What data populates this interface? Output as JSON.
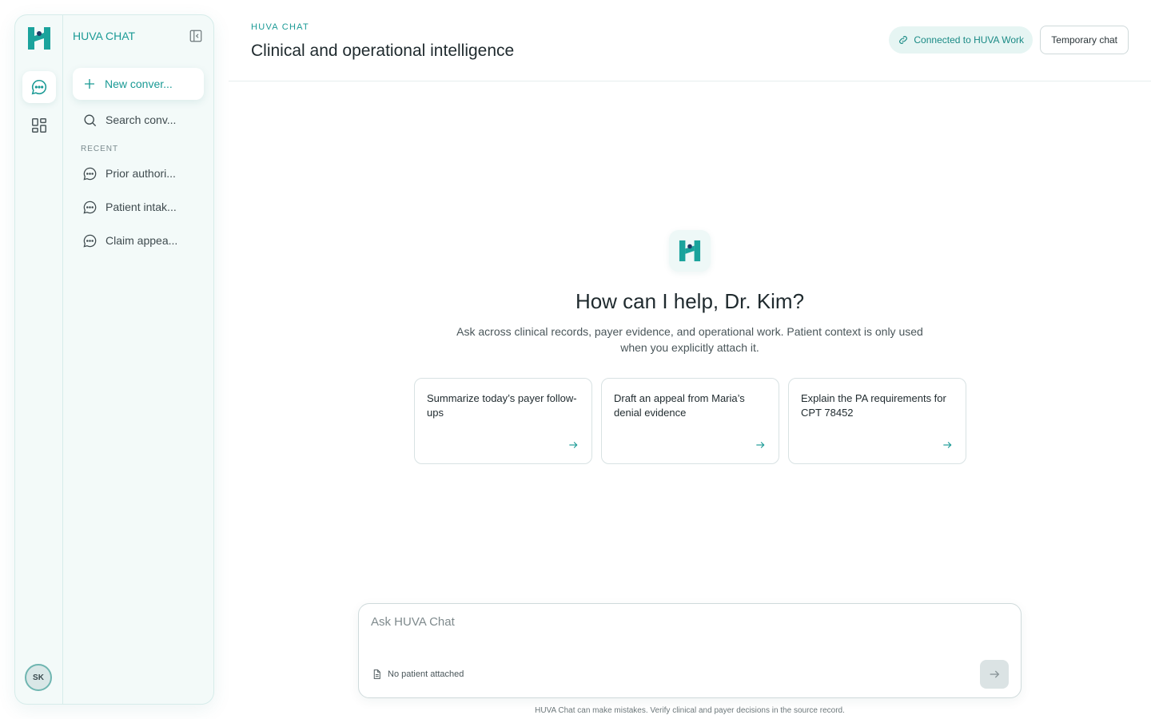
{
  "sidebar": {
    "brand": "HUVA CHAT",
    "new_conversation": "New conver...",
    "search": "Search conv...",
    "recent_label": "RECENT",
    "recent": [
      {
        "label": "Prior authori..."
      },
      {
        "label": "Patient intak..."
      },
      {
        "label": "Claim appea..."
      }
    ],
    "avatar_initials": "SK"
  },
  "header": {
    "eyebrow": "HUVA CHAT",
    "title": "Clinical and operational intelligence",
    "connection": "Connected to HUVA Work",
    "temporary": "Temporary chat"
  },
  "hero": {
    "greeting": "How can I help, Dr. Kim?",
    "subtitle": "Ask across clinical records, payer evidence, and operational work. Patient context is only used when you explicitly attach it."
  },
  "suggestions": [
    {
      "text": "Summarize today’s payer follow-ups"
    },
    {
      "text": "Draft an appeal from Maria’s denial evidence"
    },
    {
      "text": "Explain the PA requirements for CPT 78452"
    }
  ],
  "composer": {
    "placeholder": "Ask HUVA Chat",
    "attachment": "No patient attached"
  },
  "disclaimer": "HUVA Chat can make mistakes. Verify clinical and payer decisions in the source record.",
  "colors": {
    "accent": "#1a9a95",
    "accent_bg": "#e6f5f3",
    "border": "#d6ecea"
  }
}
